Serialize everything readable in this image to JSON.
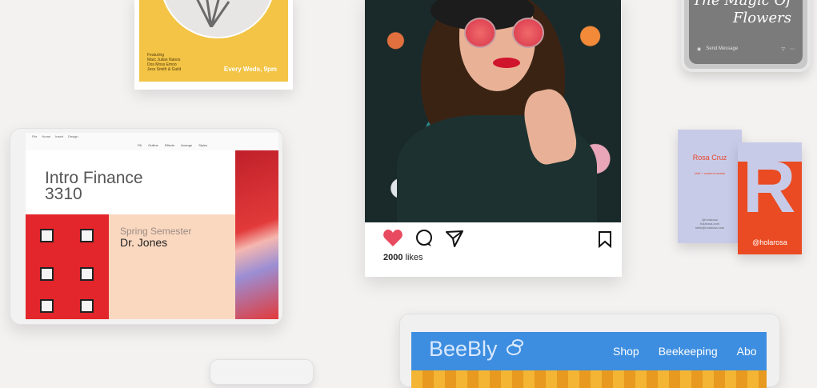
{
  "poster": {
    "details": "Featuring\nMarc Julian Nanos\nDos Moss Emoo\nJess Smith & Guild",
    "schedule": "Every Weds, 9pm"
  },
  "phone": {
    "title": "The Magic Of Flowers",
    "message_placeholder": "Send Message"
  },
  "tablet": {
    "ribbon_tabs": [
      "File",
      "Home",
      "Insert",
      "Design"
    ],
    "ribbon_tools": [
      "Fill",
      "Outline",
      "Effects",
      "Arrange",
      "Styles"
    ],
    "slide_title": "Intro Finance 3310",
    "semester": "Spring Semester",
    "professor": "Dr. Jones"
  },
  "instagram": {
    "likes_count": "2000",
    "likes_label": "likes",
    "colors": {
      "heart": "#e84a5f"
    }
  },
  "business_card_front": {
    "name": "Rosa Cruz",
    "role": "chef + content creator",
    "contact": "@holarosa\nholarosa.com\nhello@holarosa.com"
  },
  "business_card_back": {
    "letter": "R",
    "handle": "@holarosa"
  },
  "website": {
    "logo": "BeeBly",
    "nav": [
      "Shop",
      "Beekeeping",
      "Abo"
    ]
  }
}
